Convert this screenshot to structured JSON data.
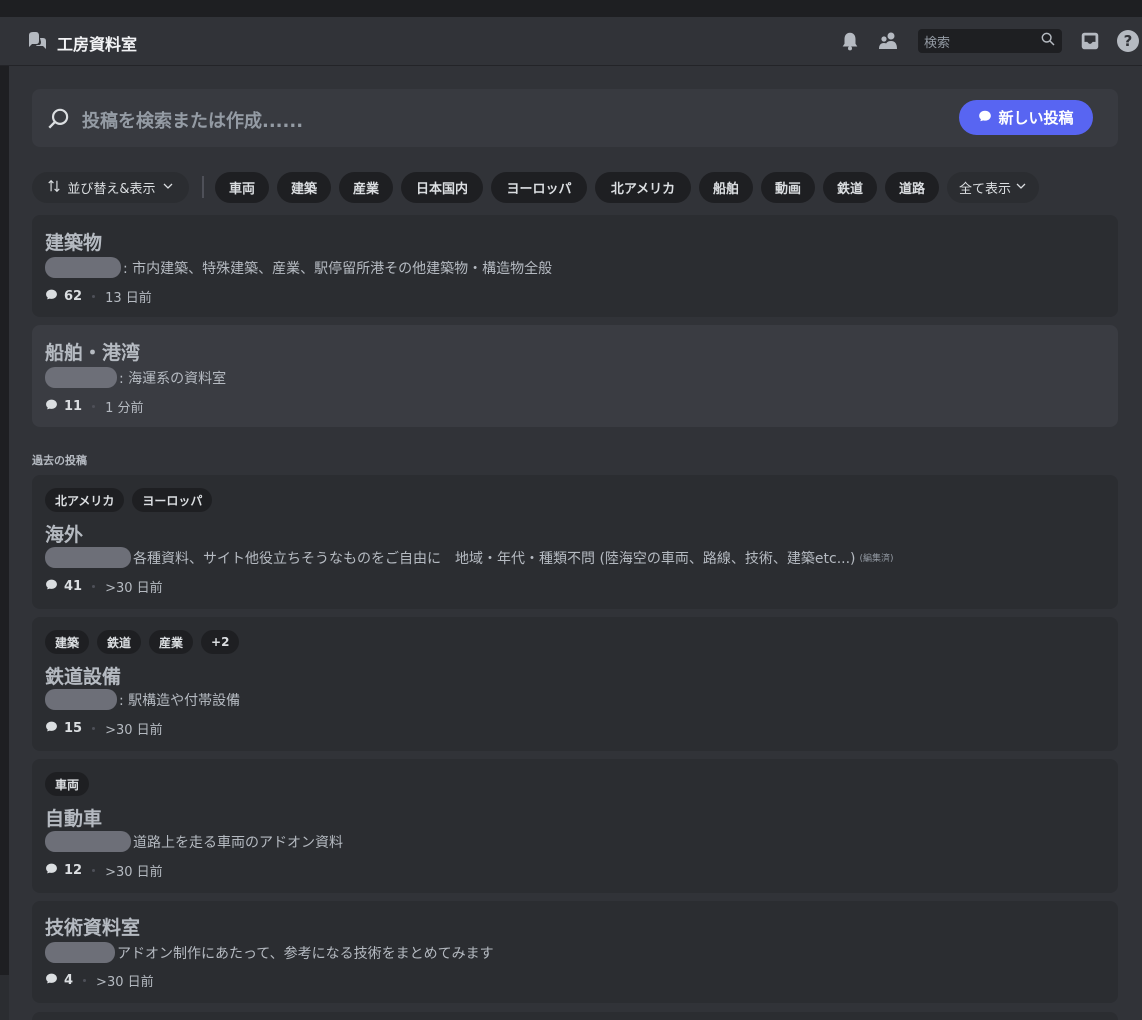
{
  "header": {
    "channel_title": "工房資料室",
    "search_placeholder": "検索",
    "icons": [
      "forum-channel-icon",
      "bell-icon",
      "members-icon",
      "search-icon",
      "inbox-icon",
      "help-icon"
    ]
  },
  "composer": {
    "placeholder": "投稿を検索または作成......",
    "new_post_label": "新しい投稿"
  },
  "filters": {
    "sort_label": "並び替え&表示",
    "tags": [
      "車両",
      "建築",
      "産業",
      "日本国内",
      "ヨーロッパ",
      "北アメリカ",
      "船舶",
      "動画",
      "鉄道",
      "道路"
    ],
    "show_all_label": "全て表示"
  },
  "pinned_posts": [
    {
      "title": "建築物",
      "desc": ": 市内建築、特殊建築、産業、駅停留所港その他建築物・構造物全般",
      "count": "62",
      "time": "13 日前"
    },
    {
      "title": "船舶・港湾",
      "desc": ": 海運系の資料室",
      "count": "11",
      "time": "1 分前"
    }
  ],
  "section_label": "過去の投稿",
  "past_posts": [
    {
      "tags": [
        "北アメリカ",
        "ヨーロッパ"
      ],
      "title": "海外",
      "desc": "各種資料、サイト他役立ちそうなものをご自由に　地域・年代・種類不問 (陸海空の車両、路線、技術、建築etc...)",
      "edited": "(編集済)",
      "count": "41",
      "time": ">30 日前"
    },
    {
      "tags": [
        "建築",
        "鉄道",
        "産業",
        "+2"
      ],
      "title": "鉄道設備",
      "desc": ": 駅構造や付帯設備",
      "count": "15",
      "time": ">30 日前"
    },
    {
      "tags": [
        "車両"
      ],
      "title": "自動車",
      "desc": "道路上を走る車両のアドオン資料",
      "count": "12",
      "time": ">30 日前"
    },
    {
      "tags": [],
      "title": "技術資料室",
      "desc": "アドオン制作にあたって、参考になる技術をまとめてみます",
      "count": "4",
      "time": ">30 日前"
    }
  ]
}
